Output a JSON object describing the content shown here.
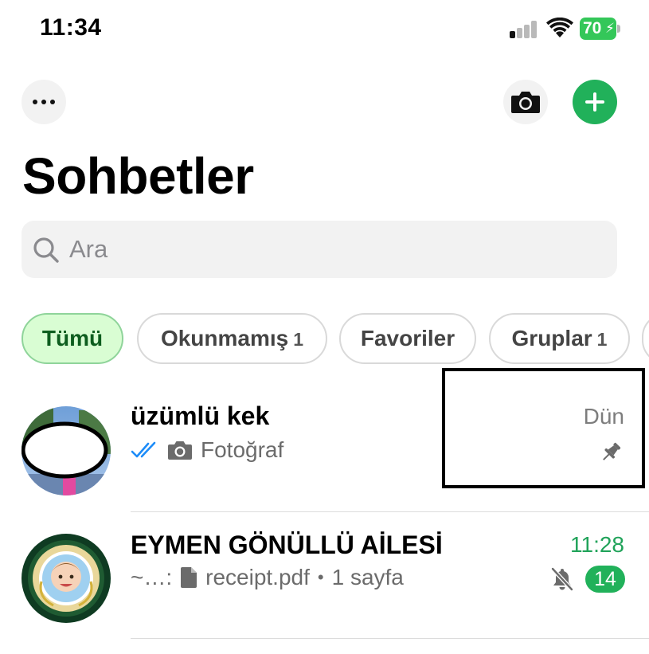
{
  "status_bar": {
    "time": "11:34",
    "battery": "70"
  },
  "header": {
    "title": "Sohbetler"
  },
  "search": {
    "placeholder": "Ara"
  },
  "filters": [
    {
      "label": "Tümü",
      "count": "",
      "active": true
    },
    {
      "label": "Okunmamış",
      "count": "1",
      "active": false
    },
    {
      "label": "Favoriler",
      "count": "",
      "active": false
    },
    {
      "label": "Gruplar",
      "count": "1",
      "active": false
    }
  ],
  "chats": [
    {
      "name": "üzümlü kek",
      "preview_icons": [
        "double-check-icon",
        "camera-icon"
      ],
      "preview": "Fotoğraf",
      "time": "Dün",
      "pinned": true
    },
    {
      "name": "EYMEN GÖNÜLLÜ AİLESİ",
      "preview_prefix": "~…:",
      "preview_icons": [
        "document-icon"
      ],
      "preview": "receipt.pdf",
      "preview_separator": "•",
      "preview_suffix": "1 sayfa",
      "time": "11:28",
      "muted": true,
      "unread": "14"
    }
  ],
  "colors": {
    "accent": "#21b15a",
    "chip_active_bg": "#d9fdd3",
    "read_receipt": "#1d8cf8",
    "unread_time": "#21a35a"
  }
}
